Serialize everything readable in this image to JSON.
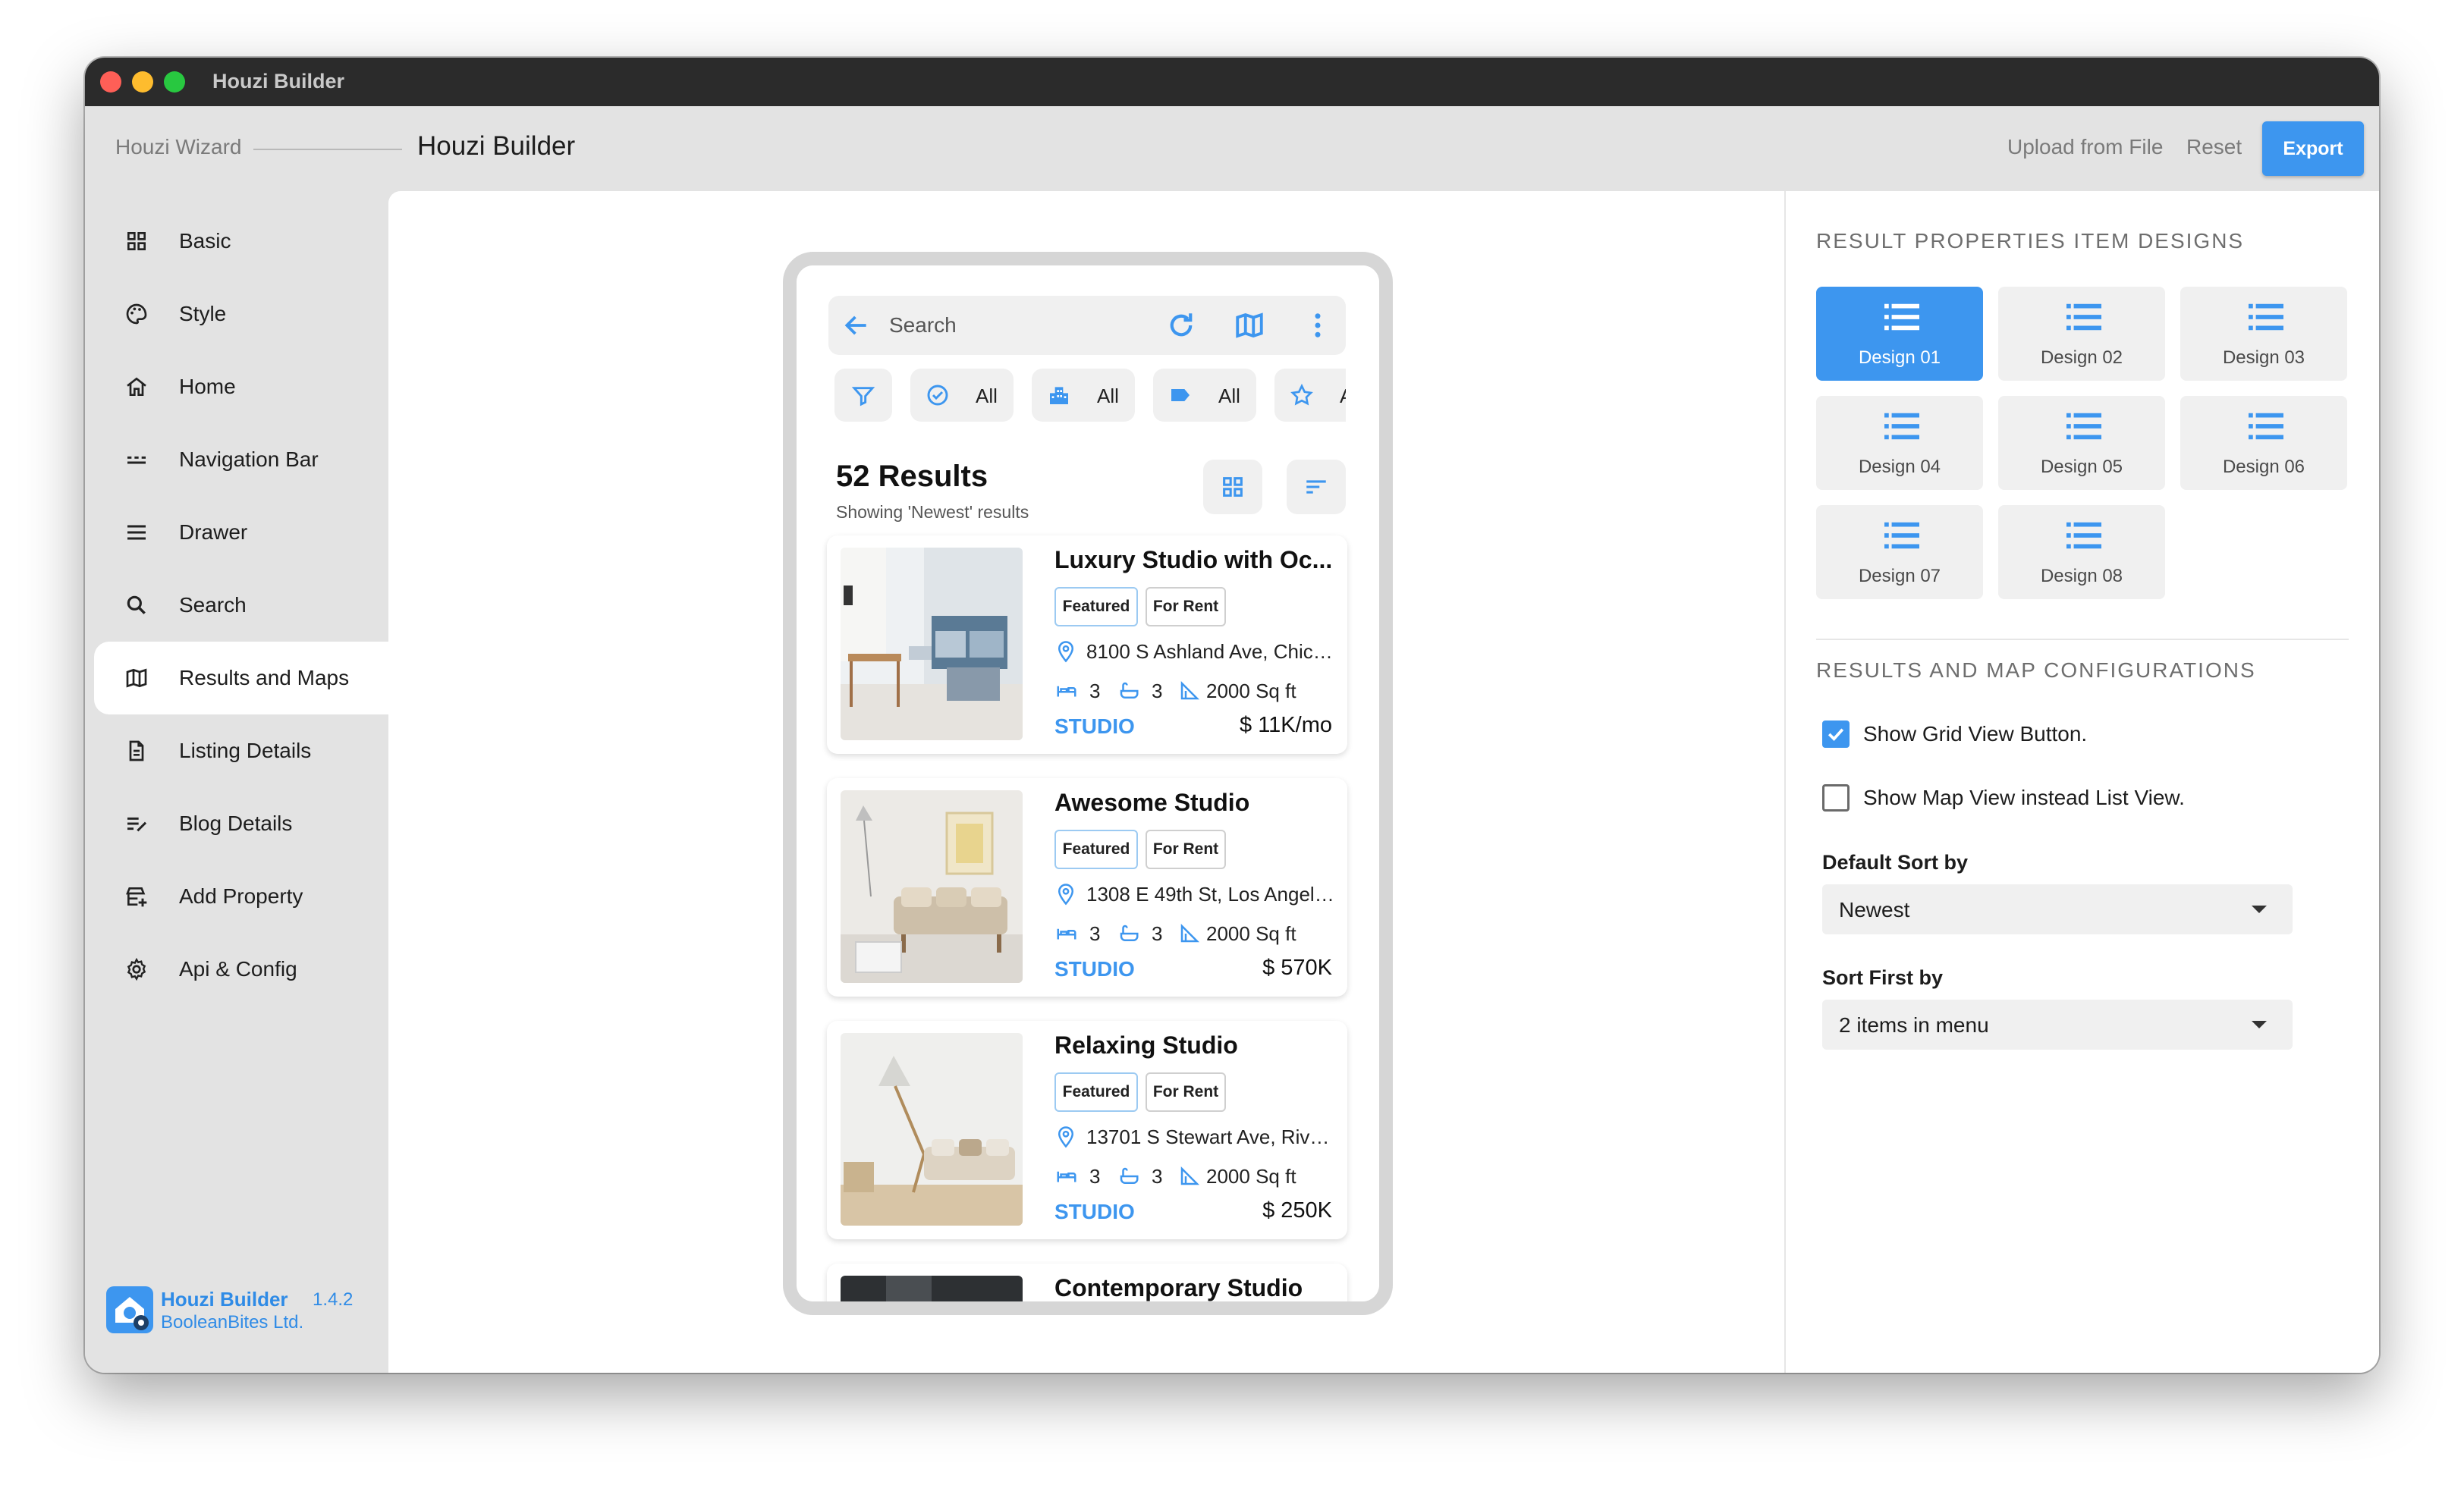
{
  "window": {
    "title": "Houzi Builder"
  },
  "topbar": {
    "wizard": "Houzi Wizard",
    "builder": "Houzi Builder",
    "upload": "Upload from File",
    "reset": "Reset",
    "export": "Export"
  },
  "sidebar": {
    "items": [
      {
        "label": "Basic",
        "icon": "grid-icon"
      },
      {
        "label": "Style",
        "icon": "palette-icon"
      },
      {
        "label": "Home",
        "icon": "home-icon"
      },
      {
        "label": "Navigation Bar",
        "icon": "navbar-icon"
      },
      {
        "label": "Drawer",
        "icon": "menu-icon"
      },
      {
        "label": "Search",
        "icon": "search-icon"
      },
      {
        "label": "Results and Maps",
        "icon": "map-icon"
      },
      {
        "label": "Listing Details",
        "icon": "document-icon"
      },
      {
        "label": "Blog Details",
        "icon": "edit-list-icon"
      },
      {
        "label": "Add Property",
        "icon": "add-property-icon"
      },
      {
        "label": "Api & Config",
        "icon": "gear-icon"
      }
    ],
    "active_index": 6,
    "brand": {
      "name": "Houzi Builder",
      "version": "1.4.2",
      "company": "BooleanBites Ltd."
    }
  },
  "phone": {
    "search_placeholder": "Search",
    "chips": [
      {
        "icon": "filter-icon",
        "label": ""
      },
      {
        "icon": "check-circle-icon",
        "label": "All"
      },
      {
        "icon": "building-icon",
        "label": "All"
      },
      {
        "icon": "tag-icon",
        "label": "All"
      },
      {
        "icon": "star-icon",
        "label": "A"
      }
    ],
    "results_title": "52 Results",
    "results_sub": "Showing 'Newest' results",
    "cards": [
      {
        "title": "Luxury Studio with Oc...",
        "tags": [
          "Featured",
          "For Rent"
        ],
        "address": "8100 S Ashland Ave, Chica...",
        "beds": "3",
        "baths": "3",
        "area": "2000 Sq ft",
        "type": "STUDIO",
        "price": "$ 11K/mo"
      },
      {
        "title": "Awesome Studio",
        "tags": [
          "Featured",
          "For Rent"
        ],
        "address": "1308 E 49th St, Los Angele...",
        "beds": "3",
        "baths": "3",
        "area": "2000 Sq ft",
        "type": "STUDIO",
        "price": "$ 570K"
      },
      {
        "title": "Relaxing Studio",
        "tags": [
          "Featured",
          "For Rent"
        ],
        "address": "13701 S Stewart Ave, Rive...",
        "beds": "3",
        "baths": "3",
        "area": "2000 Sq ft",
        "type": "STUDIO",
        "price": "$ 250K"
      },
      {
        "title": "Contemporary Studio"
      }
    ]
  },
  "panel": {
    "designs_heading": "RESULT PROPERTIES ITEM DESIGNS",
    "designs": [
      "Design 01",
      "Design 02",
      "Design 03",
      "Design 04",
      "Design 05",
      "Design 06",
      "Design 07",
      "Design 08"
    ],
    "selected_design": "Design 01",
    "config_heading": "RESULTS AND MAP CONFIGURATIONS",
    "grid_button": {
      "label": "Show Grid View Button.",
      "checked": true
    },
    "map_view": {
      "label": "Show Map View instead List View.",
      "checked": false
    },
    "sort_label": "Default Sort by",
    "sort_value": "Newest",
    "sort_first_label": "Sort First by",
    "sort_first_value": "2 items in menu"
  },
  "colors": {
    "accent": "#3d96ef",
    "sidebar_bg": "#e3e3e3",
    "titlebar": "#2b2b2b"
  }
}
